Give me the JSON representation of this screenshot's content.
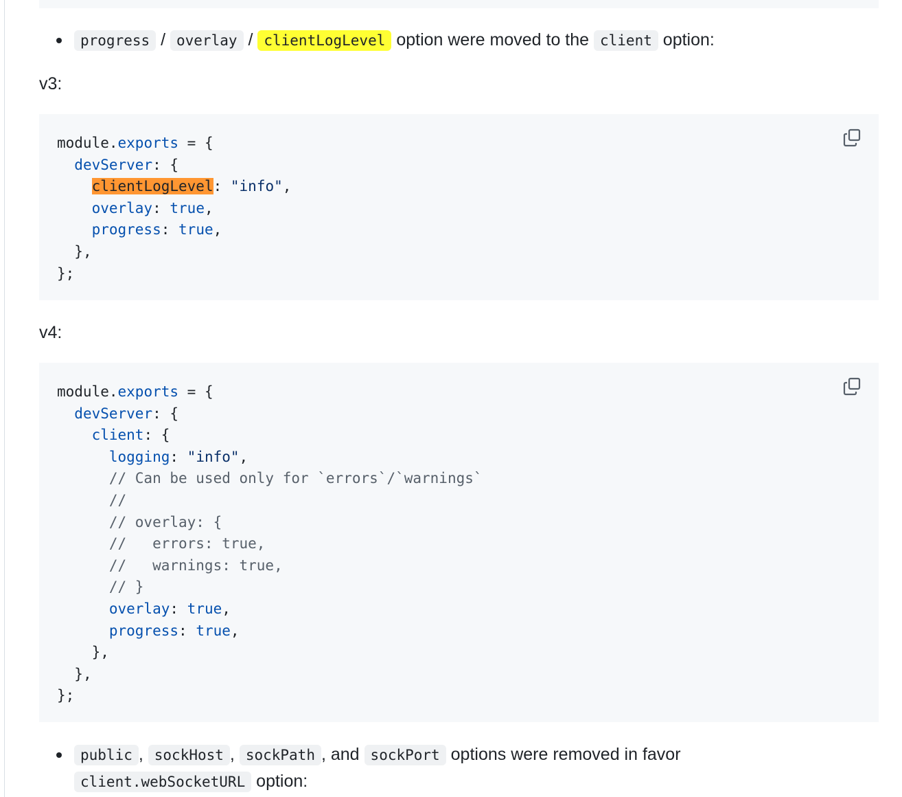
{
  "bullet1": {
    "code_progress": "progress",
    "sep1": " / ",
    "code_overlay": "overlay",
    "sep2": " / ",
    "code_clientLogLevel": "clientLogLevel",
    "text_moved": " option were moved to the ",
    "code_client": "client",
    "text_option": " option:"
  },
  "v3_label": "v3:",
  "v4_label": "v4:",
  "v3_code": {
    "l1_module": "module.",
    "l1_exports": "exports",
    "l1_rest": " = {",
    "l2_devServer": "devServer",
    "l2_rest": ": {",
    "l3_clientLogLevel": "clientLogLevel",
    "l3_colon": ": ",
    "l3_value": "\"info\"",
    "l3_comma": ",",
    "l4_overlay": "overlay",
    "l4_colon": ": ",
    "l4_value": "true",
    "l4_comma": ",",
    "l5_progress": "progress",
    "l5_colon": ": ",
    "l5_value": "true",
    "l5_comma": ",",
    "l6": "},",
    "l7": "};"
  },
  "v4_code": {
    "l1_module": "module.",
    "l1_exports": "exports",
    "l1_rest": " = {",
    "l2_devServer": "devServer",
    "l2_rest": ": {",
    "l3_client": "client",
    "l3_rest": ": {",
    "l4_logging": "logging",
    "l4_colon": ": ",
    "l4_value": "\"info\"",
    "l4_comma": ",",
    "c1": "// Can be used only for `errors`/`warnings`",
    "c2": "//",
    "c3": "// overlay: {",
    "c4": "//   errors: true,",
    "c5": "//   warnings: true,",
    "c6": "// }",
    "l5_overlay": "overlay",
    "l5_colon": ": ",
    "l5_value": "true",
    "l5_comma": ",",
    "l6_progress": "progress",
    "l6_colon": ": ",
    "l6_value": "true",
    "l6_comma": ",",
    "l7": "},",
    "l8": "},",
    "l9": "};"
  },
  "bullet2": {
    "code_public": "public",
    "sep1": ", ",
    "code_sockHost": "sockHost",
    "sep2": ", ",
    "code_sockPath": "sockPath",
    "sep3": ", and ",
    "code_sockPort": "sockPort",
    "text_removed": " options were removed in favor",
    "code_webSocketURL": "client.webSocketURL",
    "text_option": " option:"
  },
  "icons": {
    "copy": "copy-icon"
  }
}
